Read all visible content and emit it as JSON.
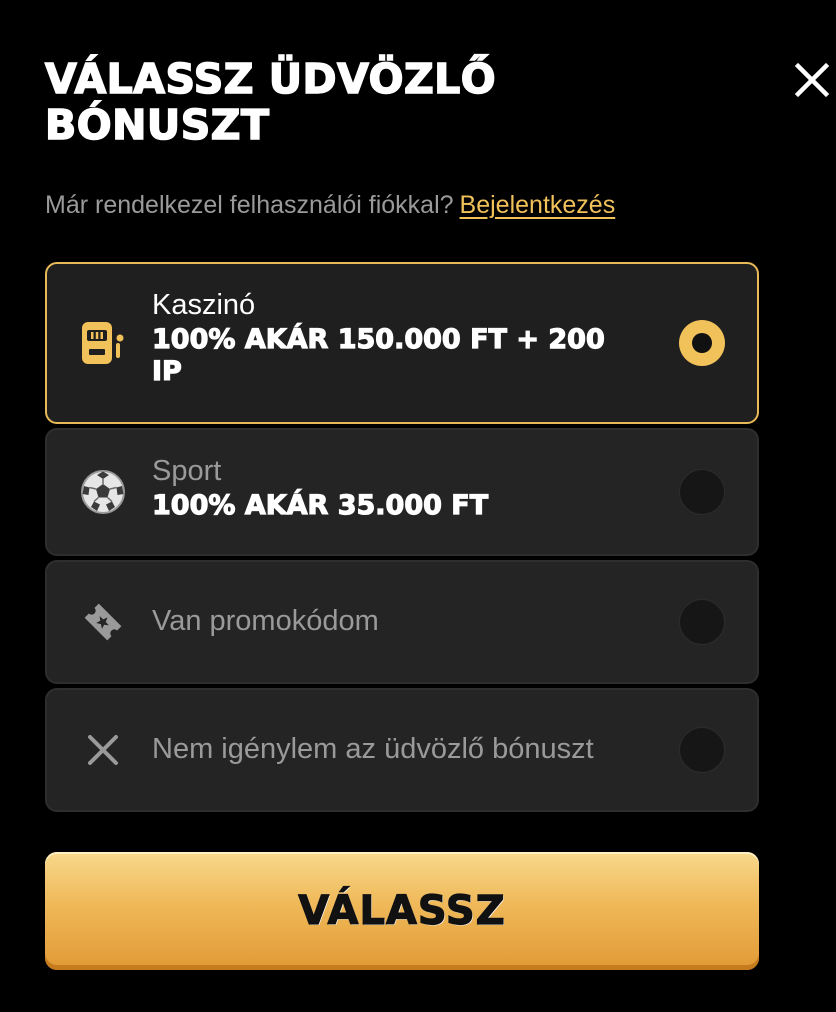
{
  "dialog": {
    "title": "VÁLASSZ ÜDVÖZLŐ BÓNUSZT",
    "close_icon": "close-icon"
  },
  "login_prompt": {
    "text": "Már rendelkezel felhasználói fiókkal?",
    "link_label": "Bejelentkezés"
  },
  "options": [
    {
      "label": "Kaszinó",
      "value": "100% AKÁR 150.000 FT + 200 IP",
      "icon": "slot-machine-icon",
      "selected": true
    },
    {
      "label": "Sport",
      "value": "100% AKÁR 35.000 FT",
      "icon": "soccer-ball-icon",
      "selected": false
    },
    {
      "label": "Van promokódom",
      "icon": "ticket-icon",
      "selected": false
    },
    {
      "label": "Nem igénylem az üdvözlő bónuszt",
      "icon": "x-icon",
      "selected": false
    }
  ],
  "submit": {
    "label": "VÁLASSZ"
  },
  "colors": {
    "background": "#000000",
    "card": "#242424",
    "accent": "#f1c15a",
    "muted_text": "#9a9a9a"
  }
}
